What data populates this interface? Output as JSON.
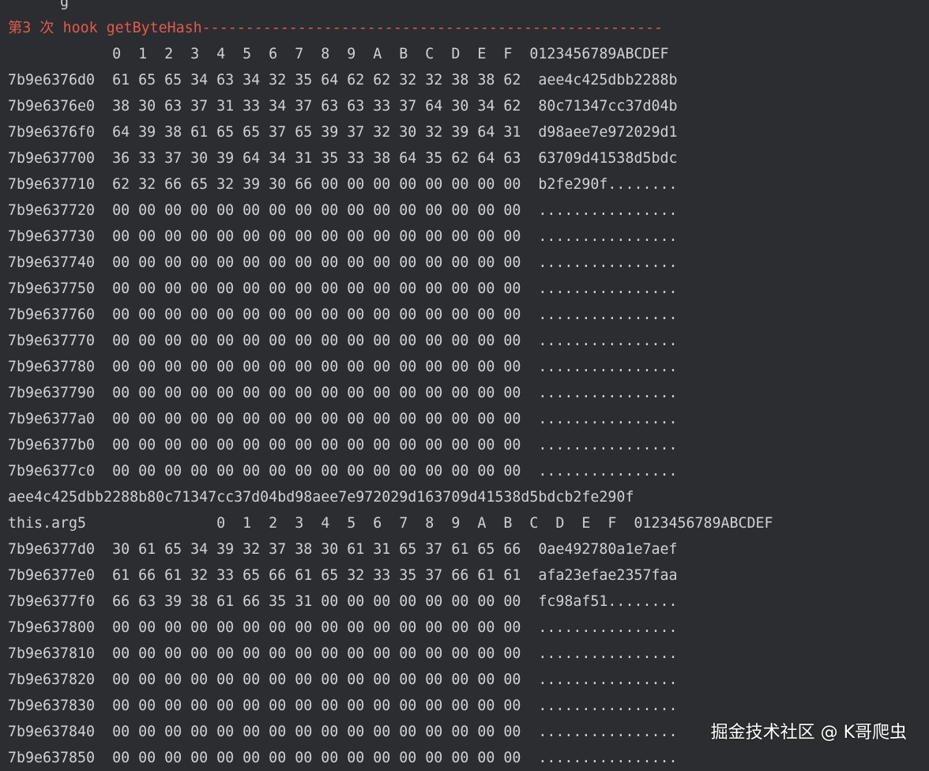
{
  "console": {
    "lines": [
      {
        "text": "      g",
        "kind": "normal"
      },
      {
        "text": "第3 次 hook getByteHash-----------------------------------------------------",
        "kind": "header"
      },
      {
        "text": "            0  1  2  3  4  5  6  7  8  9  A  B  C  D  E  F  0123456789ABCDEF",
        "kind": "normal"
      },
      {
        "text": "7b9e6376d0  61 65 65 34 63 34 32 35 64 62 62 32 32 38 38 62  aee4c425dbb2288b",
        "kind": "normal"
      },
      {
        "text": "7b9e6376e0  38 30 63 37 31 33 34 37 63 63 33 37 64 30 34 62  80c71347cc37d04b",
        "kind": "normal"
      },
      {
        "text": "7b9e6376f0  64 39 38 61 65 65 37 65 39 37 32 30 32 39 64 31  d98aee7e972029d1",
        "kind": "normal"
      },
      {
        "text": "7b9e637700  36 33 37 30 39 64 34 31 35 33 38 64 35 62 64 63  63709d41538d5bdc",
        "kind": "normal"
      },
      {
        "text": "7b9e637710  62 32 66 65 32 39 30 66 00 00 00 00 00 00 00 00  b2fe290f........",
        "kind": "normal"
      },
      {
        "text": "7b9e637720  00 00 00 00 00 00 00 00 00 00 00 00 00 00 00 00  ................",
        "kind": "normal"
      },
      {
        "text": "7b9e637730  00 00 00 00 00 00 00 00 00 00 00 00 00 00 00 00  ................",
        "kind": "normal"
      },
      {
        "text": "7b9e637740  00 00 00 00 00 00 00 00 00 00 00 00 00 00 00 00  ................",
        "kind": "normal"
      },
      {
        "text": "7b9e637750  00 00 00 00 00 00 00 00 00 00 00 00 00 00 00 00  ................",
        "kind": "normal"
      },
      {
        "text": "7b9e637760  00 00 00 00 00 00 00 00 00 00 00 00 00 00 00 00  ................",
        "kind": "normal"
      },
      {
        "text": "7b9e637770  00 00 00 00 00 00 00 00 00 00 00 00 00 00 00 00  ................",
        "kind": "normal"
      },
      {
        "text": "7b9e637780  00 00 00 00 00 00 00 00 00 00 00 00 00 00 00 00  ................",
        "kind": "normal"
      },
      {
        "text": "7b9e637790  00 00 00 00 00 00 00 00 00 00 00 00 00 00 00 00  ................",
        "kind": "normal"
      },
      {
        "text": "7b9e6377a0  00 00 00 00 00 00 00 00 00 00 00 00 00 00 00 00  ................",
        "kind": "normal"
      },
      {
        "text": "7b9e6377b0  00 00 00 00 00 00 00 00 00 00 00 00 00 00 00 00  ................",
        "kind": "normal"
      },
      {
        "text": "7b9e6377c0  00 00 00 00 00 00 00 00 00 00 00 00 00 00 00 00  ................",
        "kind": "normal"
      },
      {
        "text": "aee4c425dbb2288b80c71347cc37d04bd98aee7e972029d163709d41538d5bdcb2fe290f",
        "kind": "normal"
      },
      {
        "text": "this.arg5               0  1  2  3  4  5  6  7  8  9  A  B  C  D  E  F  0123456789ABCDEF",
        "kind": "normal"
      },
      {
        "text": "7b9e6377d0  30 61 65 34 39 32 37 38 30 61 31 65 37 61 65 66  0ae492780a1e7aef",
        "kind": "normal"
      },
      {
        "text": "7b9e6377e0  61 66 61 32 33 65 66 61 65 32 33 35 37 66 61 61  afa23efae2357faa",
        "kind": "normal"
      },
      {
        "text": "7b9e6377f0  66 63 39 38 61 66 35 31 00 00 00 00 00 00 00 00  fc98af51........",
        "kind": "normal"
      },
      {
        "text": "7b9e637800  00 00 00 00 00 00 00 00 00 00 00 00 00 00 00 00  ................",
        "kind": "normal"
      },
      {
        "text": "7b9e637810  00 00 00 00 00 00 00 00 00 00 00 00 00 00 00 00  ................",
        "kind": "normal"
      },
      {
        "text": "7b9e637820  00 00 00 00 00 00 00 00 00 00 00 00 00 00 00 00  ................",
        "kind": "normal"
      },
      {
        "text": "7b9e637830  00 00 00 00 00 00 00 00 00 00 00 00 00 00 00 00  ................",
        "kind": "normal"
      },
      {
        "text": "7b9e637840  00 00 00 00 00 00 00 00 00 00 00 00 00 00 00 00  ................",
        "kind": "normal"
      },
      {
        "text": "7b9e637850  00 00 00 00 00 00 00 00 00 00 00 00 00 00 00 00  ................",
        "kind": "normal"
      }
    ]
  },
  "watermark": {
    "text": "掘金技术社区 @ K哥爬虫"
  },
  "colors": {
    "background": "#2b2d30",
    "text": "#cfd1d6",
    "header": "#e05a4f"
  }
}
